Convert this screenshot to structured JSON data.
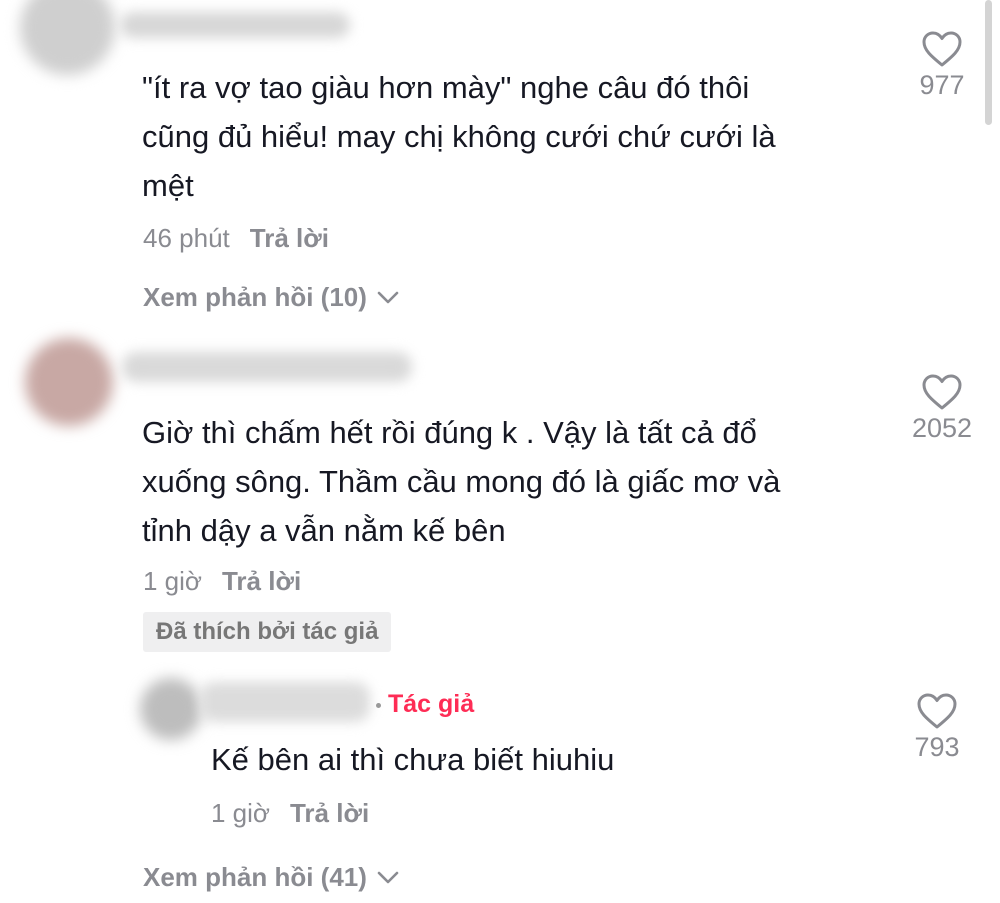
{
  "comments": [
    {
      "text_lines": [
        "\"ít ra vợ tao giàu hơn mày\" nghe câu đó thôi",
        "cũng đủ hiểu! may chị không cưới chứ cưới là",
        "mệt"
      ],
      "time": "46 phút",
      "reply_label": "Trả lời",
      "likes": "977",
      "view_replies": "Xem phản hồi (10)"
    },
    {
      "text_lines": [
        "Giờ thì chấm hết rồi đúng k . Vậy là tất cả đổ",
        "xuống sông. Thầm cầu mong đó là giấc mơ và",
        "tỉnh dậy a vẫn nằm kế bên"
      ],
      "time": "1 giờ",
      "reply_label": "Trả lời",
      "likes": "2052",
      "liked_by_author": "Đã thích bởi tác giả",
      "view_replies": "Xem phản hồi (41)"
    }
  ],
  "reply": {
    "author_tag": "Tác giả",
    "text": "Kế bên ai thì chưa biết hiuhiu",
    "time": "1 giờ",
    "reply_label": "Trả lời",
    "likes": "793"
  },
  "colors": {
    "text": "#161823",
    "secondary": "#8a8b91",
    "author_accent": "#fe2c55",
    "badge_bg": "#efeff0"
  },
  "icons": {
    "like": "heart-outline-icon",
    "expand": "chevron-down-icon"
  }
}
